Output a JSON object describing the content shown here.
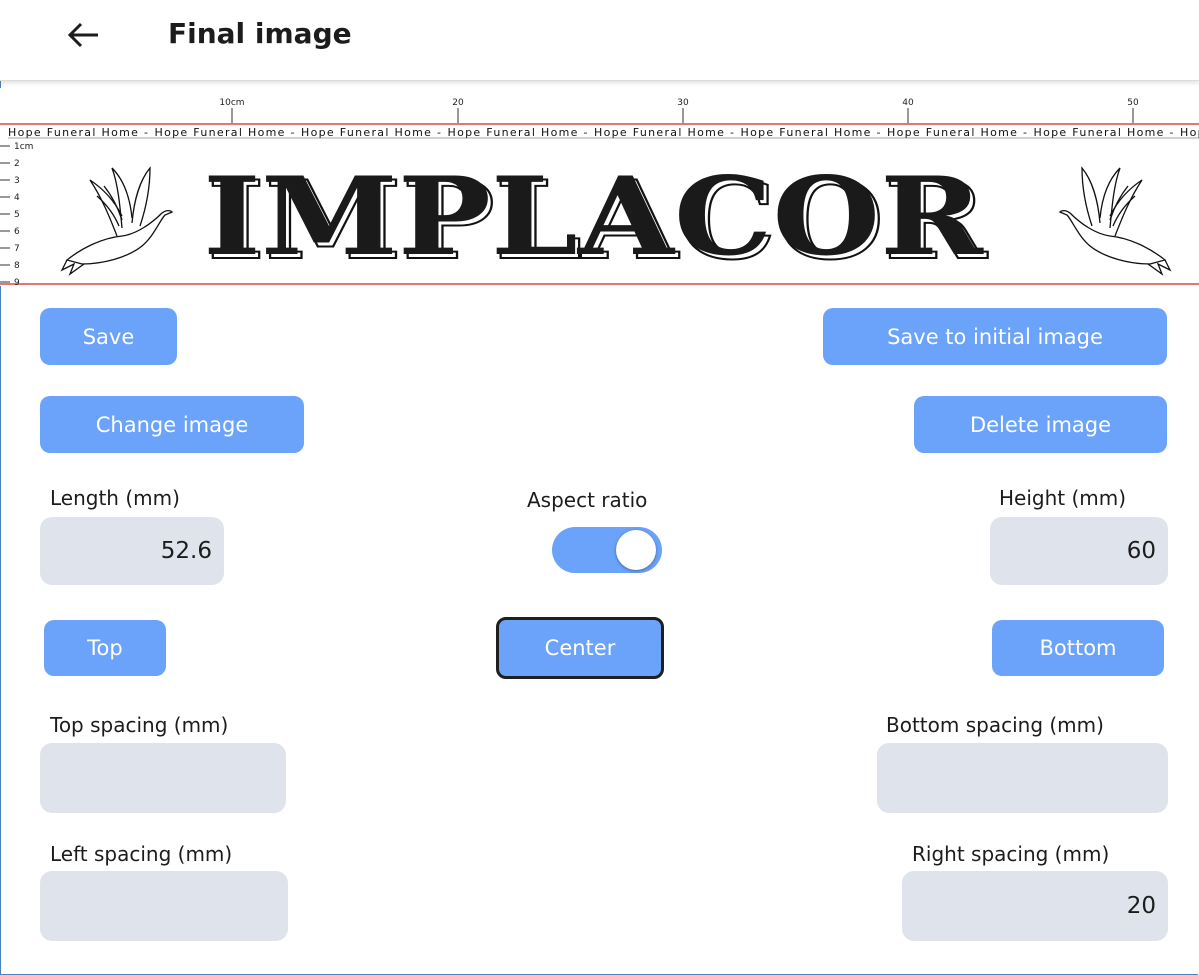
{
  "appbar": {
    "title": "Final image",
    "back_icon": "arrow-left-icon"
  },
  "preview": {
    "ruler_top_labels": [
      "10cm",
      "20",
      "30",
      "40",
      "50"
    ],
    "ruler_left_labels": [
      "1cm",
      "2",
      "3",
      "4",
      "5",
      "6",
      "7",
      "8",
      "9"
    ],
    "repeat_text": "Hope Funeral Home -",
    "headline": "IMPLACOR",
    "decoration_icon": "dove-icon",
    "guide_color": "#d94a4a"
  },
  "actions": {
    "save": "Save",
    "save_initial": "Save to initial image",
    "change_image": "Change image",
    "delete_image": "Delete image"
  },
  "dimensions": {
    "length_label": "Length (mm)",
    "length_value": "52.6",
    "aspect_label": "Aspect ratio",
    "aspect_enabled": true,
    "height_label": "Height (mm)",
    "height_value": "60"
  },
  "alignment": {
    "top": "Top",
    "center": "Center",
    "bottom": "Bottom",
    "selected": "center"
  },
  "spacing": {
    "top_label": "Top spacing (mm)",
    "top_value": "",
    "bottom_label": "Bottom spacing (mm)",
    "bottom_value": "",
    "left_label": "Left spacing (mm)",
    "left_value": "",
    "right_label": "Right spacing (mm)",
    "right_value": "20"
  },
  "colors": {
    "accent": "#6ba2fa",
    "field_bg": "#dfe4ec"
  }
}
